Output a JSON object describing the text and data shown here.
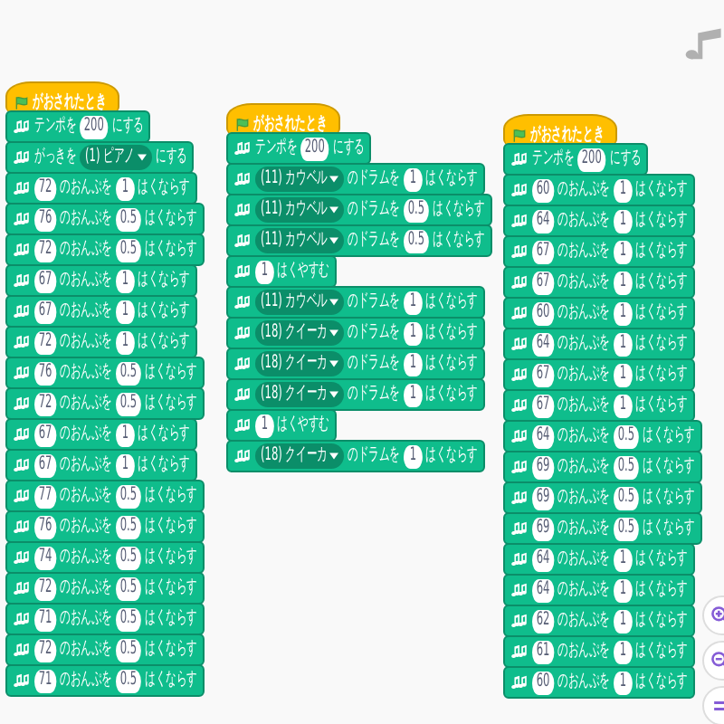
{
  "scripts": [
    {
      "hat": {
        "label": "がおされたとき"
      },
      "blocks": [
        {
          "parts": [
            {
              "kind": "text",
              "text": "テンポを"
            },
            {
              "kind": "number",
              "text": "200"
            },
            {
              "kind": "text",
              "text": "にする"
            }
          ]
        },
        {
          "parts": [
            {
              "kind": "text",
              "text": "がっきを"
            },
            {
              "kind": "dropdown",
              "text": "(1) ピアノ"
            },
            {
              "kind": "text",
              "text": "にする"
            }
          ]
        },
        {
          "parts": [
            {
              "kind": "number",
              "text": "72"
            },
            {
              "kind": "text",
              "text": "のおんぷを"
            },
            {
              "kind": "number",
              "text": "1"
            },
            {
              "kind": "text",
              "text": "はくならす"
            }
          ]
        },
        {
          "parts": [
            {
              "kind": "number",
              "text": "76"
            },
            {
              "kind": "text",
              "text": "のおんぷを"
            },
            {
              "kind": "number",
              "text": "0.5"
            },
            {
              "kind": "text",
              "text": "はくならす"
            }
          ]
        },
        {
          "parts": [
            {
              "kind": "number",
              "text": "72"
            },
            {
              "kind": "text",
              "text": "のおんぷを"
            },
            {
              "kind": "number",
              "text": "0.5"
            },
            {
              "kind": "text",
              "text": "はくならす"
            }
          ]
        },
        {
          "parts": [
            {
              "kind": "number",
              "text": "67"
            },
            {
              "kind": "text",
              "text": "のおんぷを"
            },
            {
              "kind": "number",
              "text": "1"
            },
            {
              "kind": "text",
              "text": "はくならす"
            }
          ]
        },
        {
          "parts": [
            {
              "kind": "number",
              "text": "67"
            },
            {
              "kind": "text",
              "text": "のおんぷを"
            },
            {
              "kind": "number",
              "text": "1"
            },
            {
              "kind": "text",
              "text": "はくならす"
            }
          ]
        },
        {
          "parts": [
            {
              "kind": "number",
              "text": "72"
            },
            {
              "kind": "text",
              "text": "のおんぷを"
            },
            {
              "kind": "number",
              "text": "1"
            },
            {
              "kind": "text",
              "text": "はくならす"
            }
          ]
        },
        {
          "parts": [
            {
              "kind": "number",
              "text": "76"
            },
            {
              "kind": "text",
              "text": "のおんぷを"
            },
            {
              "kind": "number",
              "text": "0.5"
            },
            {
              "kind": "text",
              "text": "はくならす"
            }
          ]
        },
        {
          "parts": [
            {
              "kind": "number",
              "text": "72"
            },
            {
              "kind": "text",
              "text": "のおんぷを"
            },
            {
              "kind": "number",
              "text": "0.5"
            },
            {
              "kind": "text",
              "text": "はくならす"
            }
          ]
        },
        {
          "parts": [
            {
              "kind": "number",
              "text": "67"
            },
            {
              "kind": "text",
              "text": "のおんぷを"
            },
            {
              "kind": "number",
              "text": "1"
            },
            {
              "kind": "text",
              "text": "はくならす"
            }
          ]
        },
        {
          "parts": [
            {
              "kind": "number",
              "text": "67"
            },
            {
              "kind": "text",
              "text": "のおんぷを"
            },
            {
              "kind": "number",
              "text": "1"
            },
            {
              "kind": "text",
              "text": "はくならす"
            }
          ]
        },
        {
          "parts": [
            {
              "kind": "number",
              "text": "77"
            },
            {
              "kind": "text",
              "text": "のおんぷを"
            },
            {
              "kind": "number",
              "text": "0.5"
            },
            {
              "kind": "text",
              "text": "はくならす"
            }
          ]
        },
        {
          "parts": [
            {
              "kind": "number",
              "text": "76"
            },
            {
              "kind": "text",
              "text": "のおんぷを"
            },
            {
              "kind": "number",
              "text": "0.5"
            },
            {
              "kind": "text",
              "text": "はくならす"
            }
          ]
        },
        {
          "parts": [
            {
              "kind": "number",
              "text": "74"
            },
            {
              "kind": "text",
              "text": "のおんぷを"
            },
            {
              "kind": "number",
              "text": "0.5"
            },
            {
              "kind": "text",
              "text": "はくならす"
            }
          ]
        },
        {
          "parts": [
            {
              "kind": "number",
              "text": "72"
            },
            {
              "kind": "text",
              "text": "のおんぷを"
            },
            {
              "kind": "number",
              "text": "0.5"
            },
            {
              "kind": "text",
              "text": "はくならす"
            }
          ]
        },
        {
          "parts": [
            {
              "kind": "number",
              "text": "71"
            },
            {
              "kind": "text",
              "text": "のおんぷを"
            },
            {
              "kind": "number",
              "text": "0.5"
            },
            {
              "kind": "text",
              "text": "はくならす"
            }
          ]
        },
        {
          "parts": [
            {
              "kind": "number",
              "text": "72"
            },
            {
              "kind": "text",
              "text": "のおんぷを"
            },
            {
              "kind": "number",
              "text": "0.5"
            },
            {
              "kind": "text",
              "text": "はくならす"
            }
          ]
        },
        {
          "parts": [
            {
              "kind": "number",
              "text": "71"
            },
            {
              "kind": "text",
              "text": "のおんぷを"
            },
            {
              "kind": "number",
              "text": "0.5"
            },
            {
              "kind": "text",
              "text": "はくならす"
            }
          ]
        }
      ]
    },
    {
      "hat": {
        "label": "がおされたとき"
      },
      "blocks": [
        {
          "parts": [
            {
              "kind": "text",
              "text": "テンポを"
            },
            {
              "kind": "number",
              "text": "200"
            },
            {
              "kind": "text",
              "text": "にする"
            }
          ]
        },
        {
          "parts": [
            {
              "kind": "dropdown",
              "text": "(11) カウベル"
            },
            {
              "kind": "text",
              "text": "のドラムを"
            },
            {
              "kind": "number",
              "text": "1"
            },
            {
              "kind": "text",
              "text": "はくならす"
            }
          ]
        },
        {
          "parts": [
            {
              "kind": "dropdown",
              "text": "(11) カウベル"
            },
            {
              "kind": "text",
              "text": "のドラムを"
            },
            {
              "kind": "number",
              "text": "0.5"
            },
            {
              "kind": "text",
              "text": "はくならす"
            }
          ]
        },
        {
          "parts": [
            {
              "kind": "dropdown",
              "text": "(11) カウベル"
            },
            {
              "kind": "text",
              "text": "のドラムを"
            },
            {
              "kind": "number",
              "text": "0.5"
            },
            {
              "kind": "text",
              "text": "はくならす"
            }
          ]
        },
        {
          "parts": [
            {
              "kind": "number",
              "text": "1"
            },
            {
              "kind": "text",
              "text": "はくやすむ"
            }
          ]
        },
        {
          "parts": [
            {
              "kind": "dropdown",
              "text": "(11) カウベル"
            },
            {
              "kind": "text",
              "text": "のドラムを"
            },
            {
              "kind": "number",
              "text": "1"
            },
            {
              "kind": "text",
              "text": "はくならす"
            }
          ]
        },
        {
          "parts": [
            {
              "kind": "dropdown",
              "text": "(18) クイーカ"
            },
            {
              "kind": "text",
              "text": "のドラムを"
            },
            {
              "kind": "number",
              "text": "1"
            },
            {
              "kind": "text",
              "text": "はくならす"
            }
          ]
        },
        {
          "parts": [
            {
              "kind": "dropdown",
              "text": "(18) クイーカ"
            },
            {
              "kind": "text",
              "text": "のドラムを"
            },
            {
              "kind": "number",
              "text": "1"
            },
            {
              "kind": "text",
              "text": "はくならす"
            }
          ]
        },
        {
          "parts": [
            {
              "kind": "dropdown",
              "text": "(18) クイーカ"
            },
            {
              "kind": "text",
              "text": "のドラムを"
            },
            {
              "kind": "number",
              "text": "1"
            },
            {
              "kind": "text",
              "text": "はくならす"
            }
          ]
        },
        {
          "parts": [
            {
              "kind": "number",
              "text": "1"
            },
            {
              "kind": "text",
              "text": "はくやすむ"
            }
          ]
        },
        {
          "parts": [
            {
              "kind": "dropdown",
              "text": "(18) クイーカ"
            },
            {
              "kind": "text",
              "text": "のドラムを"
            },
            {
              "kind": "number",
              "text": "1"
            },
            {
              "kind": "text",
              "text": "はくならす"
            }
          ]
        }
      ]
    },
    {
      "hat": {
        "label": "がおされたとき"
      },
      "blocks": [
        {
          "parts": [
            {
              "kind": "text",
              "text": "テンポを"
            },
            {
              "kind": "number",
              "text": "200"
            },
            {
              "kind": "text",
              "text": "にする"
            }
          ]
        },
        {
          "parts": [
            {
              "kind": "number",
              "text": "60"
            },
            {
              "kind": "text",
              "text": "のおんぷを"
            },
            {
              "kind": "number",
              "text": "1"
            },
            {
              "kind": "text",
              "text": "はくならす"
            }
          ]
        },
        {
          "parts": [
            {
              "kind": "number",
              "text": "64"
            },
            {
              "kind": "text",
              "text": "のおんぷを"
            },
            {
              "kind": "number",
              "text": "1"
            },
            {
              "kind": "text",
              "text": "はくならす"
            }
          ]
        },
        {
          "parts": [
            {
              "kind": "number",
              "text": "67"
            },
            {
              "kind": "text",
              "text": "のおんぷを"
            },
            {
              "kind": "number",
              "text": "1"
            },
            {
              "kind": "text",
              "text": "はくならす"
            }
          ]
        },
        {
          "parts": [
            {
              "kind": "number",
              "text": "67"
            },
            {
              "kind": "text",
              "text": "のおんぷを"
            },
            {
              "kind": "number",
              "text": "1"
            },
            {
              "kind": "text",
              "text": "はくならす"
            }
          ]
        },
        {
          "parts": [
            {
              "kind": "number",
              "text": "60"
            },
            {
              "kind": "text",
              "text": "のおんぷを"
            },
            {
              "kind": "number",
              "text": "1"
            },
            {
              "kind": "text",
              "text": "はくならす"
            }
          ]
        },
        {
          "parts": [
            {
              "kind": "number",
              "text": "64"
            },
            {
              "kind": "text",
              "text": "のおんぷを"
            },
            {
              "kind": "number",
              "text": "1"
            },
            {
              "kind": "text",
              "text": "はくならす"
            }
          ]
        },
        {
          "parts": [
            {
              "kind": "number",
              "text": "67"
            },
            {
              "kind": "text",
              "text": "のおんぷを"
            },
            {
              "kind": "number",
              "text": "1"
            },
            {
              "kind": "text",
              "text": "はくならす"
            }
          ]
        },
        {
          "parts": [
            {
              "kind": "number",
              "text": "67"
            },
            {
              "kind": "text",
              "text": "のおんぷを"
            },
            {
              "kind": "number",
              "text": "1"
            },
            {
              "kind": "text",
              "text": "はくならす"
            }
          ]
        },
        {
          "parts": [
            {
              "kind": "number",
              "text": "64"
            },
            {
              "kind": "text",
              "text": "のおんぷを"
            },
            {
              "kind": "number",
              "text": "0.5"
            },
            {
              "kind": "text",
              "text": "はくならす"
            }
          ]
        },
        {
          "parts": [
            {
              "kind": "number",
              "text": "69"
            },
            {
              "kind": "text",
              "text": "のおんぷを"
            },
            {
              "kind": "number",
              "text": "0.5"
            },
            {
              "kind": "text",
              "text": "はくならす"
            }
          ]
        },
        {
          "parts": [
            {
              "kind": "number",
              "text": "69"
            },
            {
              "kind": "text",
              "text": "のおんぷを"
            },
            {
              "kind": "number",
              "text": "0.5"
            },
            {
              "kind": "text",
              "text": "はくならす"
            }
          ]
        },
        {
          "parts": [
            {
              "kind": "number",
              "text": "69"
            },
            {
              "kind": "text",
              "text": "のおんぷを"
            },
            {
              "kind": "number",
              "text": "0.5"
            },
            {
              "kind": "text",
              "text": "はくならす"
            }
          ]
        },
        {
          "parts": [
            {
              "kind": "number",
              "text": "64"
            },
            {
              "kind": "text",
              "text": "のおんぷを"
            },
            {
              "kind": "number",
              "text": "1"
            },
            {
              "kind": "text",
              "text": "はくならす"
            }
          ]
        },
        {
          "parts": [
            {
              "kind": "number",
              "text": "64"
            },
            {
              "kind": "text",
              "text": "のおんぷを"
            },
            {
              "kind": "number",
              "text": "1"
            },
            {
              "kind": "text",
              "text": "はくならす"
            }
          ]
        },
        {
          "parts": [
            {
              "kind": "number",
              "text": "62"
            },
            {
              "kind": "text",
              "text": "のおんぷを"
            },
            {
              "kind": "number",
              "text": "1"
            },
            {
              "kind": "text",
              "text": "はくならす"
            }
          ]
        },
        {
          "parts": [
            {
              "kind": "number",
              "text": "61"
            },
            {
              "kind": "text",
              "text": "のおんぷを"
            },
            {
              "kind": "number",
              "text": "1"
            },
            {
              "kind": "text",
              "text": "はくならす"
            }
          ]
        },
        {
          "parts": [
            {
              "kind": "number",
              "text": "60"
            },
            {
              "kind": "text",
              "text": "のおんぷを"
            },
            {
              "kind": "number",
              "text": "1"
            },
            {
              "kind": "text",
              "text": "はくならす"
            }
          ]
        }
      ]
    }
  ]
}
